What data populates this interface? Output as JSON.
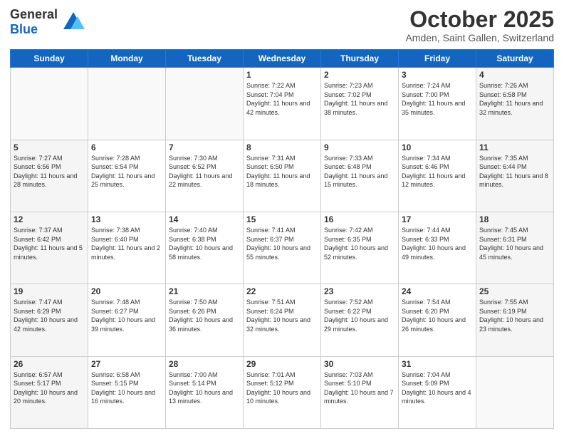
{
  "header": {
    "logo_general": "General",
    "logo_blue": "Blue",
    "month": "October 2025",
    "location": "Amden, Saint Gallen, Switzerland"
  },
  "days_of_week": [
    "Sunday",
    "Monday",
    "Tuesday",
    "Wednesday",
    "Thursday",
    "Friday",
    "Saturday"
  ],
  "weeks": [
    [
      {
        "day": "",
        "sunrise": "",
        "sunset": "",
        "daylight": "",
        "empty": true
      },
      {
        "day": "",
        "sunrise": "",
        "sunset": "",
        "daylight": "",
        "empty": true
      },
      {
        "day": "",
        "sunrise": "",
        "sunset": "",
        "daylight": "",
        "empty": true
      },
      {
        "day": "1",
        "sunrise": "Sunrise: 7:22 AM",
        "sunset": "Sunset: 7:04 PM",
        "daylight": "Daylight: 11 hours and 42 minutes.",
        "empty": false
      },
      {
        "day": "2",
        "sunrise": "Sunrise: 7:23 AM",
        "sunset": "Sunset: 7:02 PM",
        "daylight": "Daylight: 11 hours and 38 minutes.",
        "empty": false
      },
      {
        "day": "3",
        "sunrise": "Sunrise: 7:24 AM",
        "sunset": "Sunset: 7:00 PM",
        "daylight": "Daylight: 11 hours and 35 minutes.",
        "empty": false
      },
      {
        "day": "4",
        "sunrise": "Sunrise: 7:26 AM",
        "sunset": "Sunset: 6:58 PM",
        "daylight": "Daylight: 11 hours and 32 minutes.",
        "empty": false,
        "weekend": true
      }
    ],
    [
      {
        "day": "5",
        "sunrise": "Sunrise: 7:27 AM",
        "sunset": "Sunset: 6:56 PM",
        "daylight": "Daylight: 11 hours and 28 minutes.",
        "empty": false,
        "weekend": true
      },
      {
        "day": "6",
        "sunrise": "Sunrise: 7:28 AM",
        "sunset": "Sunset: 6:54 PM",
        "daylight": "Daylight: 11 hours and 25 minutes.",
        "empty": false
      },
      {
        "day": "7",
        "sunrise": "Sunrise: 7:30 AM",
        "sunset": "Sunset: 6:52 PM",
        "daylight": "Daylight: 11 hours and 22 minutes.",
        "empty": false
      },
      {
        "day": "8",
        "sunrise": "Sunrise: 7:31 AM",
        "sunset": "Sunset: 6:50 PM",
        "daylight": "Daylight: 11 hours and 18 minutes.",
        "empty": false
      },
      {
        "day": "9",
        "sunrise": "Sunrise: 7:33 AM",
        "sunset": "Sunset: 6:48 PM",
        "daylight": "Daylight: 11 hours and 15 minutes.",
        "empty": false
      },
      {
        "day": "10",
        "sunrise": "Sunrise: 7:34 AM",
        "sunset": "Sunset: 6:46 PM",
        "daylight": "Daylight: 11 hours and 12 minutes.",
        "empty": false
      },
      {
        "day": "11",
        "sunrise": "Sunrise: 7:35 AM",
        "sunset": "Sunset: 6:44 PM",
        "daylight": "Daylight: 11 hours and 8 minutes.",
        "empty": false,
        "weekend": true
      }
    ],
    [
      {
        "day": "12",
        "sunrise": "Sunrise: 7:37 AM",
        "sunset": "Sunset: 6:42 PM",
        "daylight": "Daylight: 11 hours and 5 minutes.",
        "empty": false,
        "weekend": true
      },
      {
        "day": "13",
        "sunrise": "Sunrise: 7:38 AM",
        "sunset": "Sunset: 6:40 PM",
        "daylight": "Daylight: 11 hours and 2 minutes.",
        "empty": false
      },
      {
        "day": "14",
        "sunrise": "Sunrise: 7:40 AM",
        "sunset": "Sunset: 6:38 PM",
        "daylight": "Daylight: 10 hours and 58 minutes.",
        "empty": false
      },
      {
        "day": "15",
        "sunrise": "Sunrise: 7:41 AM",
        "sunset": "Sunset: 6:37 PM",
        "daylight": "Daylight: 10 hours and 55 minutes.",
        "empty": false
      },
      {
        "day": "16",
        "sunrise": "Sunrise: 7:42 AM",
        "sunset": "Sunset: 6:35 PM",
        "daylight": "Daylight: 10 hours and 52 minutes.",
        "empty": false
      },
      {
        "day": "17",
        "sunrise": "Sunrise: 7:44 AM",
        "sunset": "Sunset: 6:33 PM",
        "daylight": "Daylight: 10 hours and 49 minutes.",
        "empty": false
      },
      {
        "day": "18",
        "sunrise": "Sunrise: 7:45 AM",
        "sunset": "Sunset: 6:31 PM",
        "daylight": "Daylight: 10 hours and 45 minutes.",
        "empty": false,
        "weekend": true
      }
    ],
    [
      {
        "day": "19",
        "sunrise": "Sunrise: 7:47 AM",
        "sunset": "Sunset: 6:29 PM",
        "daylight": "Daylight: 10 hours and 42 minutes.",
        "empty": false,
        "weekend": true
      },
      {
        "day": "20",
        "sunrise": "Sunrise: 7:48 AM",
        "sunset": "Sunset: 6:27 PM",
        "daylight": "Daylight: 10 hours and 39 minutes.",
        "empty": false
      },
      {
        "day": "21",
        "sunrise": "Sunrise: 7:50 AM",
        "sunset": "Sunset: 6:26 PM",
        "daylight": "Daylight: 10 hours and 36 minutes.",
        "empty": false
      },
      {
        "day": "22",
        "sunrise": "Sunrise: 7:51 AM",
        "sunset": "Sunset: 6:24 PM",
        "daylight": "Daylight: 10 hours and 32 minutes.",
        "empty": false
      },
      {
        "day": "23",
        "sunrise": "Sunrise: 7:52 AM",
        "sunset": "Sunset: 6:22 PM",
        "daylight": "Daylight: 10 hours and 29 minutes.",
        "empty": false
      },
      {
        "day": "24",
        "sunrise": "Sunrise: 7:54 AM",
        "sunset": "Sunset: 6:20 PM",
        "daylight": "Daylight: 10 hours and 26 minutes.",
        "empty": false
      },
      {
        "day": "25",
        "sunrise": "Sunrise: 7:55 AM",
        "sunset": "Sunset: 6:19 PM",
        "daylight": "Daylight: 10 hours and 23 minutes.",
        "empty": false,
        "weekend": true
      }
    ],
    [
      {
        "day": "26",
        "sunrise": "Sunrise: 6:57 AM",
        "sunset": "Sunset: 5:17 PM",
        "daylight": "Daylight: 10 hours and 20 minutes.",
        "empty": false,
        "weekend": true
      },
      {
        "day": "27",
        "sunrise": "Sunrise: 6:58 AM",
        "sunset": "Sunset: 5:15 PM",
        "daylight": "Daylight: 10 hours and 16 minutes.",
        "empty": false
      },
      {
        "day": "28",
        "sunrise": "Sunrise: 7:00 AM",
        "sunset": "Sunset: 5:14 PM",
        "daylight": "Daylight: 10 hours and 13 minutes.",
        "empty": false
      },
      {
        "day": "29",
        "sunrise": "Sunrise: 7:01 AM",
        "sunset": "Sunset: 5:12 PM",
        "daylight": "Daylight: 10 hours and 10 minutes.",
        "empty": false
      },
      {
        "day": "30",
        "sunrise": "Sunrise: 7:03 AM",
        "sunset": "Sunset: 5:10 PM",
        "daylight": "Daylight: 10 hours and 7 minutes.",
        "empty": false
      },
      {
        "day": "31",
        "sunrise": "Sunrise: 7:04 AM",
        "sunset": "Sunset: 5:09 PM",
        "daylight": "Daylight: 10 hours and 4 minutes.",
        "empty": false
      },
      {
        "day": "",
        "sunrise": "",
        "sunset": "",
        "daylight": "",
        "empty": true,
        "weekend": true
      }
    ]
  ]
}
